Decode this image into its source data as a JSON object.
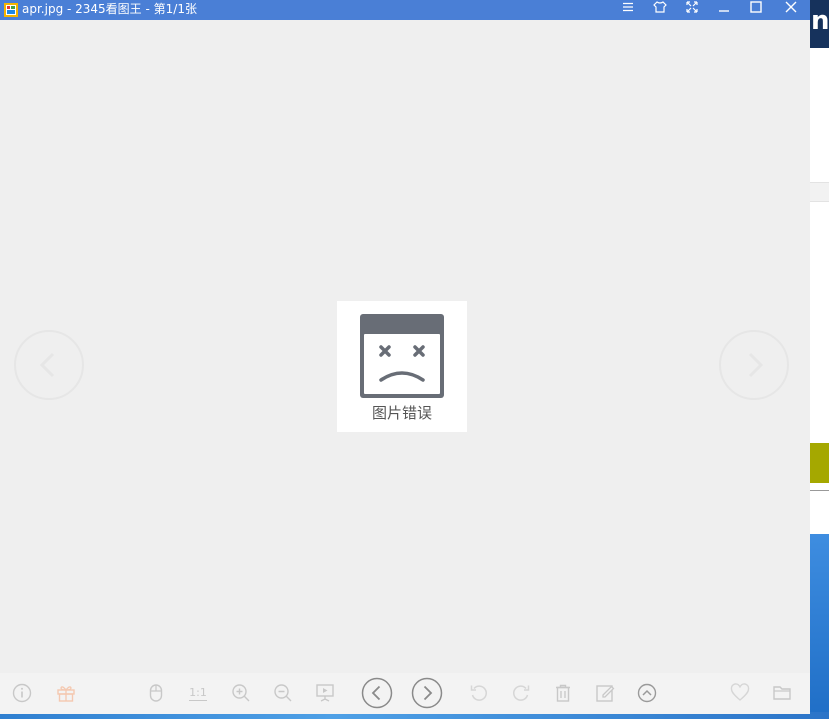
{
  "window": {
    "title": "apr.jpg - 2345看图王 - 第1/1张"
  },
  "titlebar_buttons": [
    {
      "name": "menu-icon"
    },
    {
      "name": "skin-icon"
    },
    {
      "name": "fullscreen-icon"
    },
    {
      "name": "minimize-icon"
    },
    {
      "name": "maximize-icon"
    },
    {
      "name": "close-icon"
    }
  ],
  "viewer": {
    "error_text": "图片错误"
  },
  "toolbar": {
    "one_to_one_label": "1:1"
  },
  "colors": {
    "titlebar": "#4a7fd6",
    "viewer_bg": "#efefef",
    "error_icon": "#686d76",
    "toolbar_icon": "#c8c8c8"
  }
}
